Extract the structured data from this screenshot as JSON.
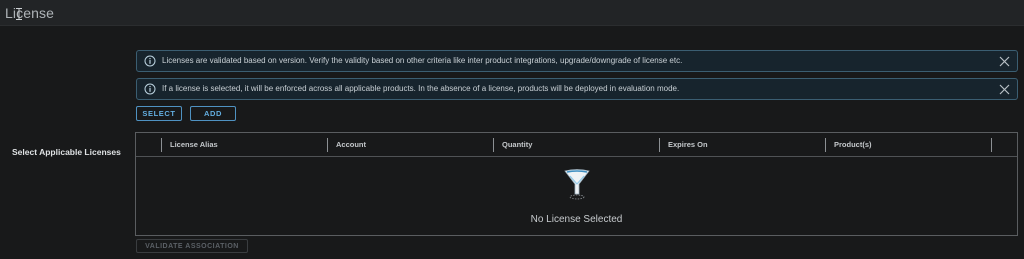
{
  "header": {
    "title": "License"
  },
  "alerts": [
    {
      "message": "Licenses are validated based on version. Verify the validity based on other criteria like inter product integrations, upgrade/downgrade of license etc.",
      "icon": "info-icon"
    },
    {
      "message": "If a license is selected, it will be enforced across all applicable products. In the absence of a license, products will be deployed in evaluation mode.",
      "icon": "info-icon"
    }
  ],
  "actions": {
    "select_label": "SELECT",
    "add_label": "ADD"
  },
  "field_label": "Select Applicable Licenses",
  "grid": {
    "columns": [
      "License Alias",
      "Account",
      "Quantity",
      "Expires On",
      "Product(s)"
    ],
    "empty_text": "No License Selected"
  },
  "validate_label": "VALIDATE ASSOCIATION",
  "colors": {
    "accent": "#63aee0",
    "alert_border": "#3b5e72",
    "background": "#18191a"
  }
}
